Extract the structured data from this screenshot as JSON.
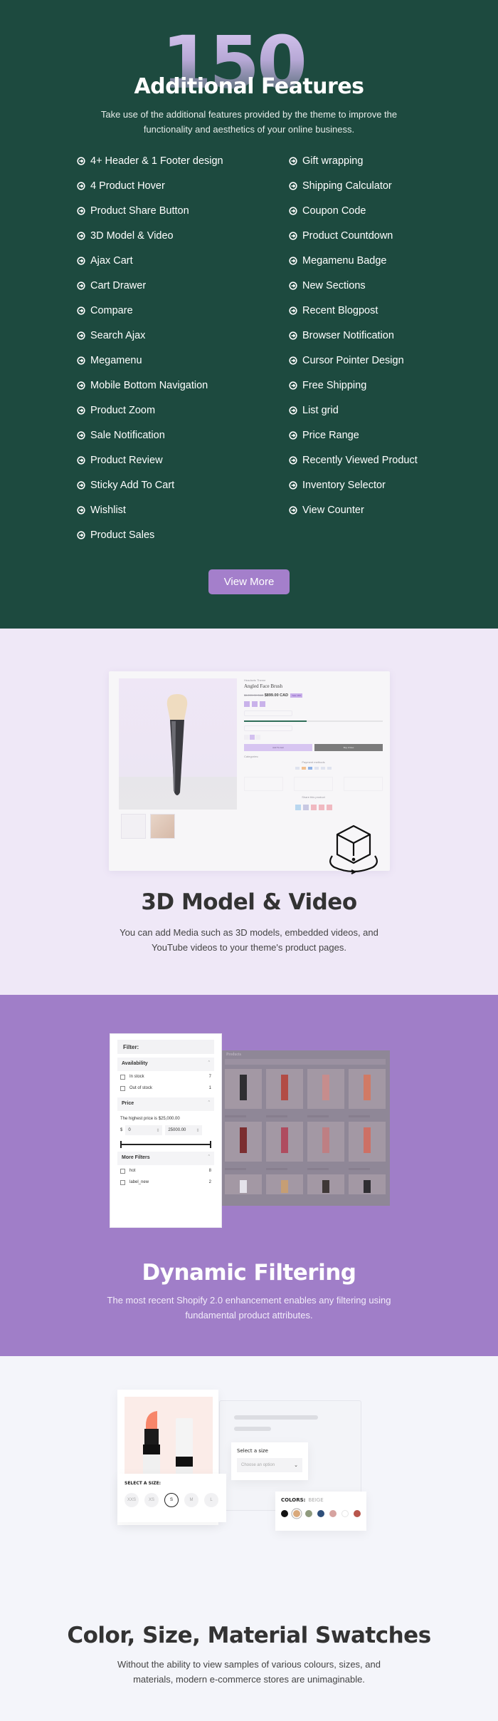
{
  "features": {
    "big_number": "150",
    "big_number_suffix": "+",
    "title": "Additional Features",
    "subtitle": "Take use of the additional features provided by the theme to improve the functionality and aesthetics of your online business.",
    "item_icon": "circle-arrow-right-icon",
    "left_column": [
      "4+ Header & 1 Footer design",
      "4 Product Hover",
      "Product Share Button",
      "3D Model & Video",
      "Ajax Cart",
      "Cart Drawer",
      "Compare",
      "Search Ajax",
      "Megamenu",
      "Mobile Bottom Navigation",
      "Product Zoom",
      "Sale Notification",
      "Product Review",
      "Sticky Add To Cart",
      "Wishlist",
      "Product Sales"
    ],
    "right_column": [
      "Gift wrapping",
      "Shipping Calculator",
      "Coupon Code",
      "Product Countdown",
      "Megamenu Badge",
      "New Sections",
      "Recent Blogpost",
      "Browser Notification",
      "Cursor Pointer Design",
      "Free Shipping",
      "List grid",
      "Price Range",
      "Recently Viewed Product",
      "Inventory Selector",
      "View Counter"
    ],
    "view_more_label": "View More"
  },
  "model_section": {
    "title": "3D Model & Video",
    "subtitle": "You can add Media such as 3D models, embedded videos, and YouTube videos to your theme's product pages.",
    "mockup": {
      "vendor": "Headsets Theme",
      "product_title": "Angled Face Brush",
      "compare_price": "$1,099.00 CAD",
      "price": "$899.00 CAD",
      "sale_badge": "Sale 18%",
      "stock_progress_percent": 45,
      "add_to_cart": "Add To Cart",
      "buy_now": "Buy It Now",
      "categories_label": "Categories:",
      "payment_methods_label": "Payment methods",
      "share_label": "Share this product"
    },
    "icon": "3d-rotate-cube-icon"
  },
  "filtering_section": {
    "title": "Dynamic Filtering",
    "subtitle": "The most recent Shopify 2.0 enhancement enables any filtering using fundamental product attributes.",
    "filter_panel": {
      "header": "Filter:",
      "availability": {
        "label": "Availability",
        "options": [
          {
            "label": "In stock",
            "count": "7"
          },
          {
            "label": "Out of stock",
            "count": "1"
          }
        ]
      },
      "price": {
        "label": "Price",
        "note": "The highest price is $25,000.00",
        "currency": "$",
        "min": "0",
        "max": "25000.00"
      },
      "more_filters": {
        "label": "More Filters",
        "options": [
          {
            "label": "hot",
            "count": "8"
          },
          {
            "label": "label_new",
            "count": "2"
          }
        ]
      }
    },
    "products_panel": {
      "title": "Products"
    }
  },
  "swatches_section": {
    "title": "Color, Size, Material Swatches",
    "subtitle": "Without the ability to view samples of various colours, sizes, and materials, modern e-commerce stores are unimaginable.",
    "size_select": {
      "label": "Select a size",
      "placeholder": "Choose an option"
    },
    "colors": {
      "label": "COLORS:",
      "selected": "BEIGE",
      "swatches": [
        "#111111",
        "#d9a97c",
        "#8f9a7d",
        "#2f4f7a",
        "#d6a3a0",
        "#ffffff",
        "#b8564c"
      ]
    },
    "size_picker": {
      "label": "SELECT A SIZE:",
      "sizes": [
        "XXS",
        "XS",
        "S",
        "M",
        "L"
      ],
      "selected": "S"
    }
  },
  "colors": {
    "features_bg": "#1d4a3f",
    "model_bg": "#efe8f7",
    "filtering_bg": "#a07ec8",
    "swatches_bg": "#f4f5fa",
    "accent": "#a47fcb"
  }
}
